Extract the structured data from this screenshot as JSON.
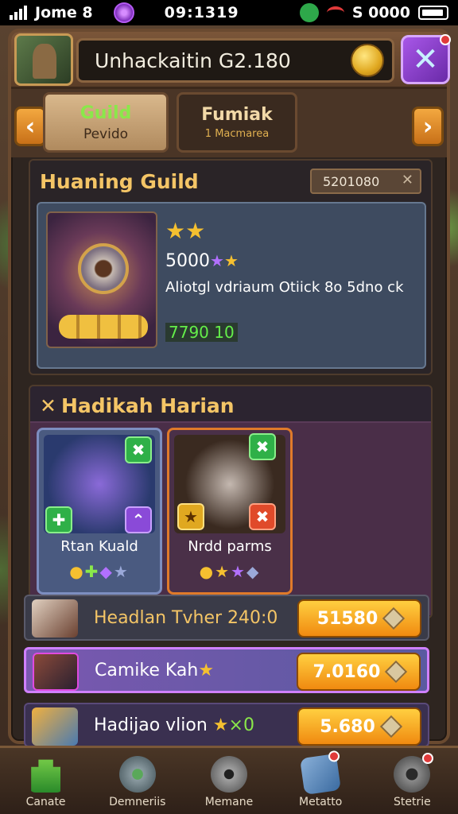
{
  "status": {
    "carrier": "Jome 8",
    "time": "09:1319",
    "right_text": "S 0000"
  },
  "header": {
    "title": "Unhackaitin G2.180"
  },
  "tabs": [
    {
      "label": "Guild",
      "sub": "Pevido"
    },
    {
      "label": "Fumiak",
      "sub": "1 Macmarea"
    }
  ],
  "guild_section": {
    "title": "Huaning Guild",
    "pill_value": "5201080",
    "card": {
      "stars": "★★",
      "value": "5000",
      "description": "Aliotgl vdriaum Otiick 8o 5dno ck",
      "green_value": "7790 10"
    }
  },
  "daily_section": {
    "title": "Hadikah Harian",
    "rewards": [
      {
        "name": "Rtan Kuald",
        "mini_tl": "✚",
        "mini_tr": "✖",
        "mini_bl": "✚",
        "mini_br": "⌃"
      },
      {
        "name": "Nrdd parms",
        "mini_tr": "✖",
        "mini_bl": "★",
        "mini_br": "✖"
      }
    ]
  },
  "rows": [
    {
      "label": "Headlan Tvher 240:0",
      "price": "51580"
    },
    {
      "label": "Camike Kah",
      "price": "7.0160"
    },
    {
      "label": "Hadijao vlion",
      "suffix": "×0",
      "price": "5.680"
    }
  ],
  "nav": [
    {
      "label": "Canate",
      "icon": "castle-icon"
    },
    {
      "label": "Demneriis",
      "icon": "compass-icon"
    },
    {
      "label": "Memane",
      "icon": "shield-icon"
    },
    {
      "label": "Metatto",
      "icon": "map-icon"
    },
    {
      "label": "Stetrie",
      "icon": "gear-icon"
    }
  ]
}
